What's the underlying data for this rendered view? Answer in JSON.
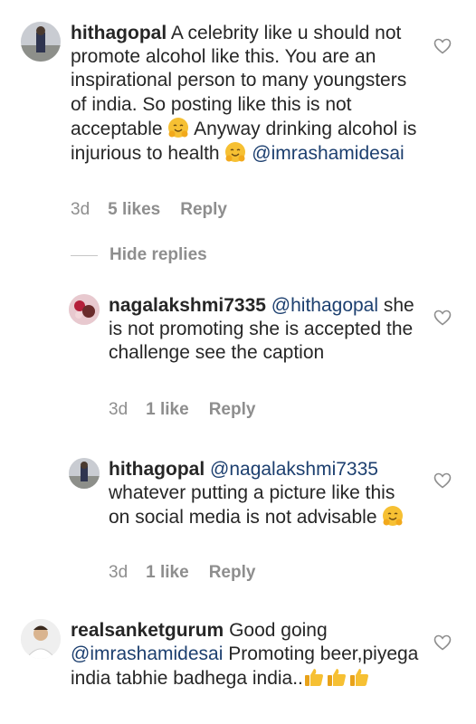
{
  "comments": [
    {
      "username": "hithagopal",
      "text_before": "A celebrity like u should not promote alcohol like this. You are an inspirational person to many youngsters of india. So posting like this is not acceptable ",
      "text_middle": " Anyway drinking alcohol is injurious to health ",
      "mention": "@imrashamidesai",
      "time": "3d",
      "likes": "5 likes",
      "reply_label": "Reply"
    },
    {
      "username": "nagalakshmi7335",
      "mention": "@hithagopal",
      "text": "she is not promoting she is accepted the challenge see the caption",
      "time": "3d",
      "likes": "1 like",
      "reply_label": "Reply"
    },
    {
      "username": "hithagopal",
      "mention": "@nagalakshmi7335",
      "text": "whatever putting a picture like this on social media is not advisable ",
      "time": "3d",
      "likes": "1 like",
      "reply_label": "Reply"
    },
    {
      "username": "realsanketgurum",
      "text_before": "Good going",
      "mention": "@imrashamidesai",
      "text_after": "Promoting beer,piyega india tabhie badhega india..",
      "reply_label": ""
    }
  ],
  "hide_replies_label": "Hide replies",
  "icons": {
    "like": "heart-outline-icon",
    "hug": "hugging-face-emoji",
    "thumbs": "thumbs-up-emoji"
  },
  "colors": {
    "text": "#262626",
    "meta": "#8e8e8e",
    "mention": "#1c3f6f",
    "emoji": "#f6c033"
  }
}
